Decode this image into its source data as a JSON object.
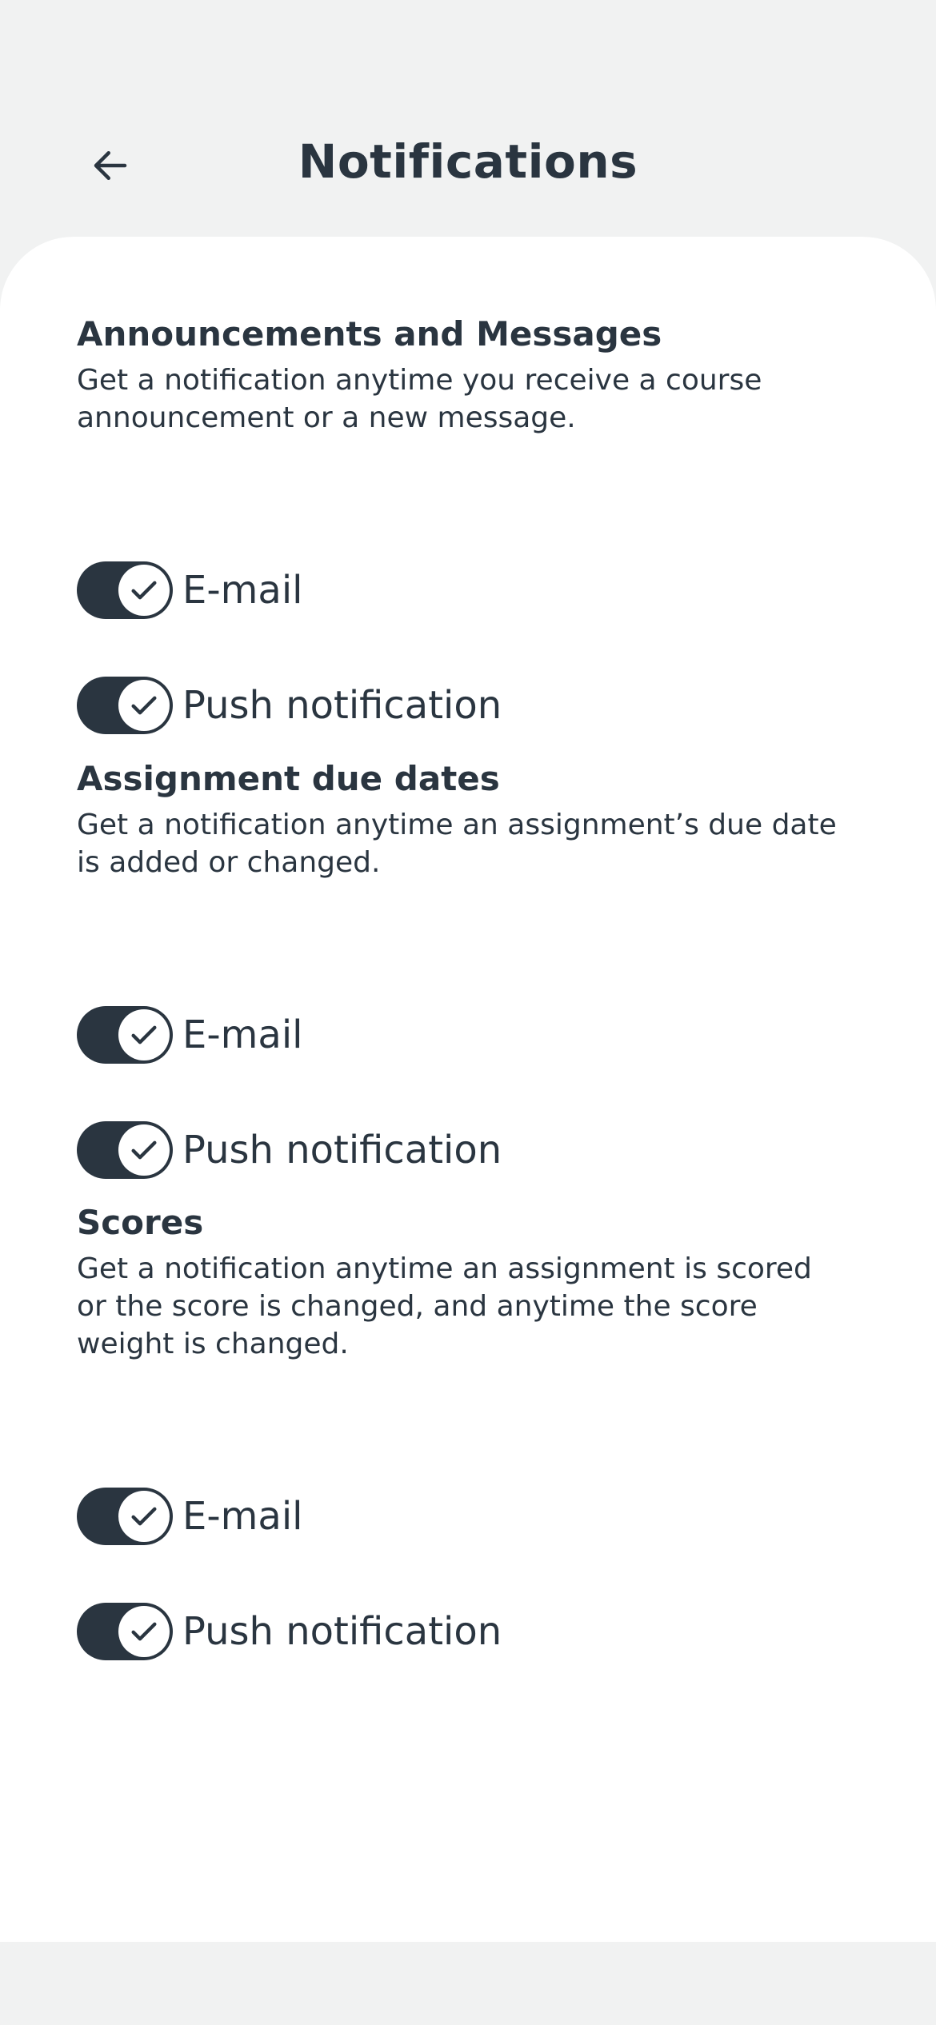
{
  "header": {
    "title": "Notifications",
    "back_icon": "arrow-left-icon"
  },
  "colors": {
    "background": "#f1f2f2",
    "sheet": "#ffffff",
    "text": "#2a3540",
    "toggle_on": "#2a3540"
  },
  "sections": [
    {
      "title": "Announcements and Messages",
      "description": "Get a notification anytime you receive a course announcement or a new message.",
      "toggles": [
        {
          "label": "E-mail",
          "checked": true
        },
        {
          "label": "Push notification",
          "checked": true
        }
      ]
    },
    {
      "title": "Assignment due dates",
      "description": "Get a notification anytime an assignment’s due date is added or changed.",
      "toggles": [
        {
          "label": "E-mail",
          "checked": true
        },
        {
          "label": "Push notification",
          "checked": true
        }
      ]
    },
    {
      "title": "Scores",
      "description": "Get a notification anytime an assignment is scored or the score is changed, and anytime the score weight is changed.",
      "toggles": [
        {
          "label": "E-mail",
          "checked": true
        },
        {
          "label": "Push notification",
          "checked": true
        }
      ]
    }
  ]
}
